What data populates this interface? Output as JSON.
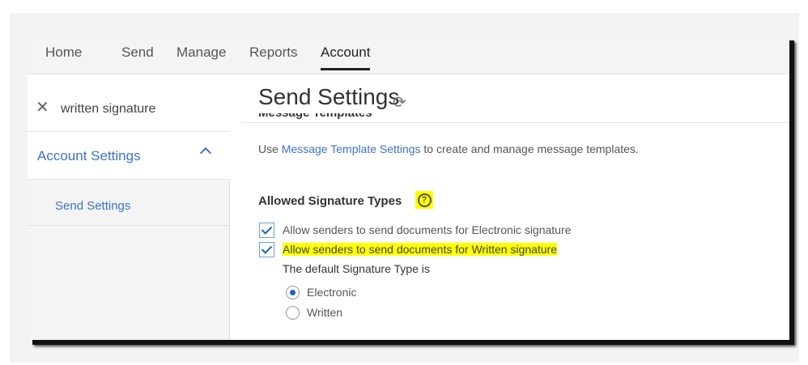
{
  "nav": {
    "tabs": [
      "Home",
      "Send",
      "Manage",
      "Reports",
      "Account"
    ],
    "active": "Account"
  },
  "sidebar": {
    "search_value": "written signature",
    "section": "Account Settings",
    "item": "Send Settings"
  },
  "main": {
    "title": "Send Settings",
    "clipped_heading": "Message Templates",
    "desc_prefix": "Use ",
    "desc_link": "Message Template Settings",
    "desc_suffix": " to create and manage message templates.",
    "allowed_heading": "Allowed Signature Types",
    "help": "?",
    "checkboxes": [
      {
        "label": "Allow senders to send documents for Electronic signature",
        "checked": true
      },
      {
        "label": "Allow senders to send documents for Written signature",
        "checked": true
      }
    ],
    "default_label": "The default Signature Type is",
    "radios": [
      {
        "label": "Electronic",
        "selected": true
      },
      {
        "label": "Written",
        "selected": false
      }
    ]
  }
}
